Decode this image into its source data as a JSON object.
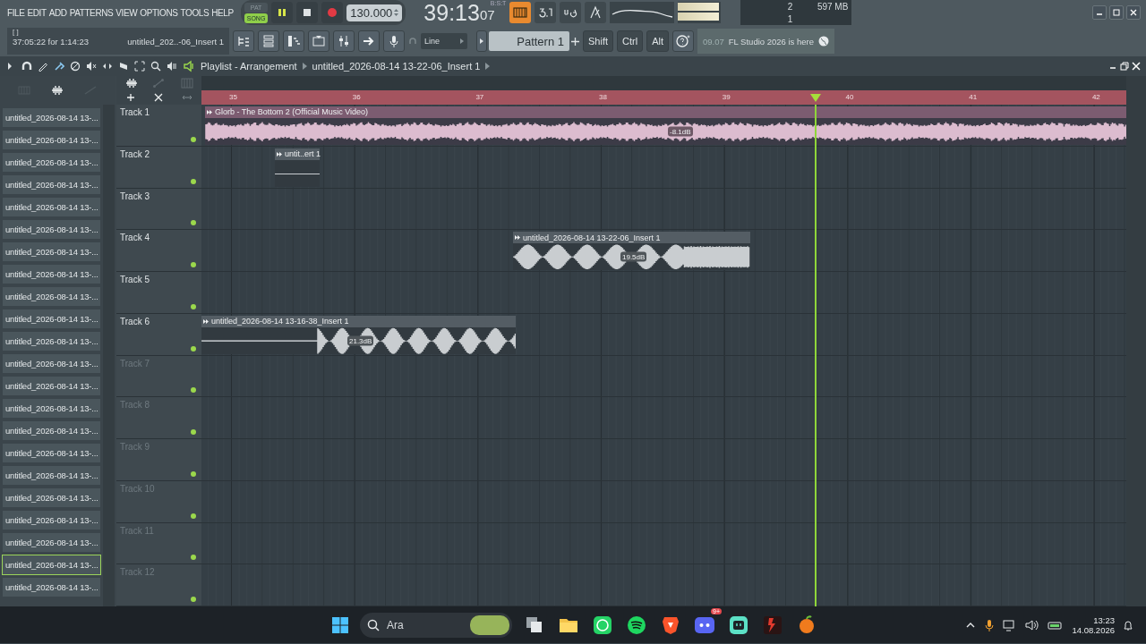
{
  "menu": [
    "FILE",
    "EDIT",
    "ADD",
    "PATTERNS",
    "VIEW",
    "OPTIONS",
    "TOOLS",
    "HELP"
  ],
  "transport": {
    "modes": [
      {
        "label": "PAT",
        "selected": false
      },
      {
        "label": "SONG",
        "selected": true
      }
    ],
    "playing": true,
    "tempo": "130.000"
  },
  "time": {
    "main": "39:13",
    "sub": "07",
    "unit": "B:S:T"
  },
  "output_meter": {
    "level": 0.95
  },
  "stats": {
    "cpu": "2",
    "memory": "597 MB",
    "polyphony": "1"
  },
  "hint": {
    "bracket": "[ ]",
    "text": "37:05:22 for 1:14:23",
    "item": "untitled_202..-06_Insert 1"
  },
  "snap": "Line",
  "pattern": "Pattern 1",
  "modifiers": [
    "Shift",
    "Ctrl",
    "Alt"
  ],
  "news": {
    "date": "09.07",
    "text": "FL Studio 2026 is here"
  },
  "picker": {
    "items": [
      {
        "label": "untitled_2026-08-14 13-...",
        "selected": false
      },
      {
        "label": "untitled_2026-08-14 13-...",
        "selected": false
      },
      {
        "label": "untitled_2026-08-14 13-...",
        "selected": false
      },
      {
        "label": "untitled_2026-08-14 13-...",
        "selected": false
      },
      {
        "label": "untitled_2026-08-14 13-...",
        "selected": false
      },
      {
        "label": "untitled_2026-08-14 13-...",
        "selected": false
      },
      {
        "label": "untitled_2026-08-14 13-...",
        "selected": false
      },
      {
        "label": "untitled_2026-08-14 13-...",
        "selected": false
      },
      {
        "label": "untitled_2026-08-14 13-...",
        "selected": false
      },
      {
        "label": "untitled_2026-08-14 13-...",
        "selected": false
      },
      {
        "label": "untitled_2026-08-14 13-...",
        "selected": false
      },
      {
        "label": "untitled_2026-08-14 13-...",
        "selected": false
      },
      {
        "label": "untitled_2026-08-14 13-...",
        "selected": false
      },
      {
        "label": "untitled_2026-08-14 13-...",
        "selected": false
      },
      {
        "label": "untitled_2026-08-14 13-...",
        "selected": false
      },
      {
        "label": "untitled_2026-08-14 13-...",
        "selected": false
      },
      {
        "label": "untitled_2026-08-14 13-...",
        "selected": false
      },
      {
        "label": "untitled_2026-08-14 13-...",
        "selected": false
      },
      {
        "label": "untitled_2026-08-14 13-...",
        "selected": false
      },
      {
        "label": "untitled_2026-08-14 13-...",
        "selected": false
      },
      {
        "label": "untitled_2026-08-14 13-...",
        "selected": true
      },
      {
        "label": "untitled_2026-08-14 13-...",
        "selected": false
      }
    ]
  },
  "playlist": {
    "title": "Playlist - Arrangement",
    "breadcrumb": "untitled_2026-08-14 13-22-06_Insert 1",
    "ruler": [
      "35",
      "36",
      "37",
      "38",
      "39",
      "40",
      "41",
      "42"
    ],
    "tracks": [
      {
        "name": "Track 1",
        "greyed": false,
        "enabled": true,
        "clips": [
          {
            "kind": "audio",
            "title": "Glorb - The Bottom 2 (Official Music Video)",
            "gain": "-8.1dB",
            "color": "#dcbccf"
          }
        ]
      },
      {
        "name": "Track 2",
        "greyed": false,
        "enabled": true,
        "clips": [
          {
            "kind": "silent",
            "title": "untit..ert 1",
            "color": "#c9cdd0"
          }
        ]
      },
      {
        "name": "Track 3",
        "greyed": false,
        "enabled": true
      },
      {
        "name": "Track 4",
        "greyed": false,
        "enabled": true,
        "clips": [
          {
            "kind": "audio",
            "title": "untitled_2026-08-14 13-22-06_Insert 1",
            "gain": "19.5dB",
            "color": "#c9cdd0"
          }
        ]
      },
      {
        "name": "Track 5",
        "greyed": false,
        "enabled": true
      },
      {
        "name": "Track 6",
        "greyed": false,
        "enabled": true,
        "clips": [
          {
            "kind": "audio",
            "title": "untitled_2026-08-14 13-16-38_Insert 1",
            "gain": "21.3dB",
            "color": "#c9cdd0"
          }
        ]
      },
      {
        "name": "Track 7",
        "greyed": true,
        "enabled": true
      },
      {
        "name": "Track 8",
        "greyed": true,
        "enabled": true
      },
      {
        "name": "Track 9",
        "greyed": true,
        "enabled": true
      },
      {
        "name": "Track 10",
        "greyed": true,
        "enabled": true
      },
      {
        "name": "Track 11",
        "greyed": true,
        "enabled": true
      },
      {
        "name": "Track 12",
        "greyed": true,
        "enabled": true
      }
    ]
  },
  "taskbar": {
    "search": "Ara",
    "badge": "9+",
    "time": "13:23",
    "date": "14.08.2026"
  }
}
